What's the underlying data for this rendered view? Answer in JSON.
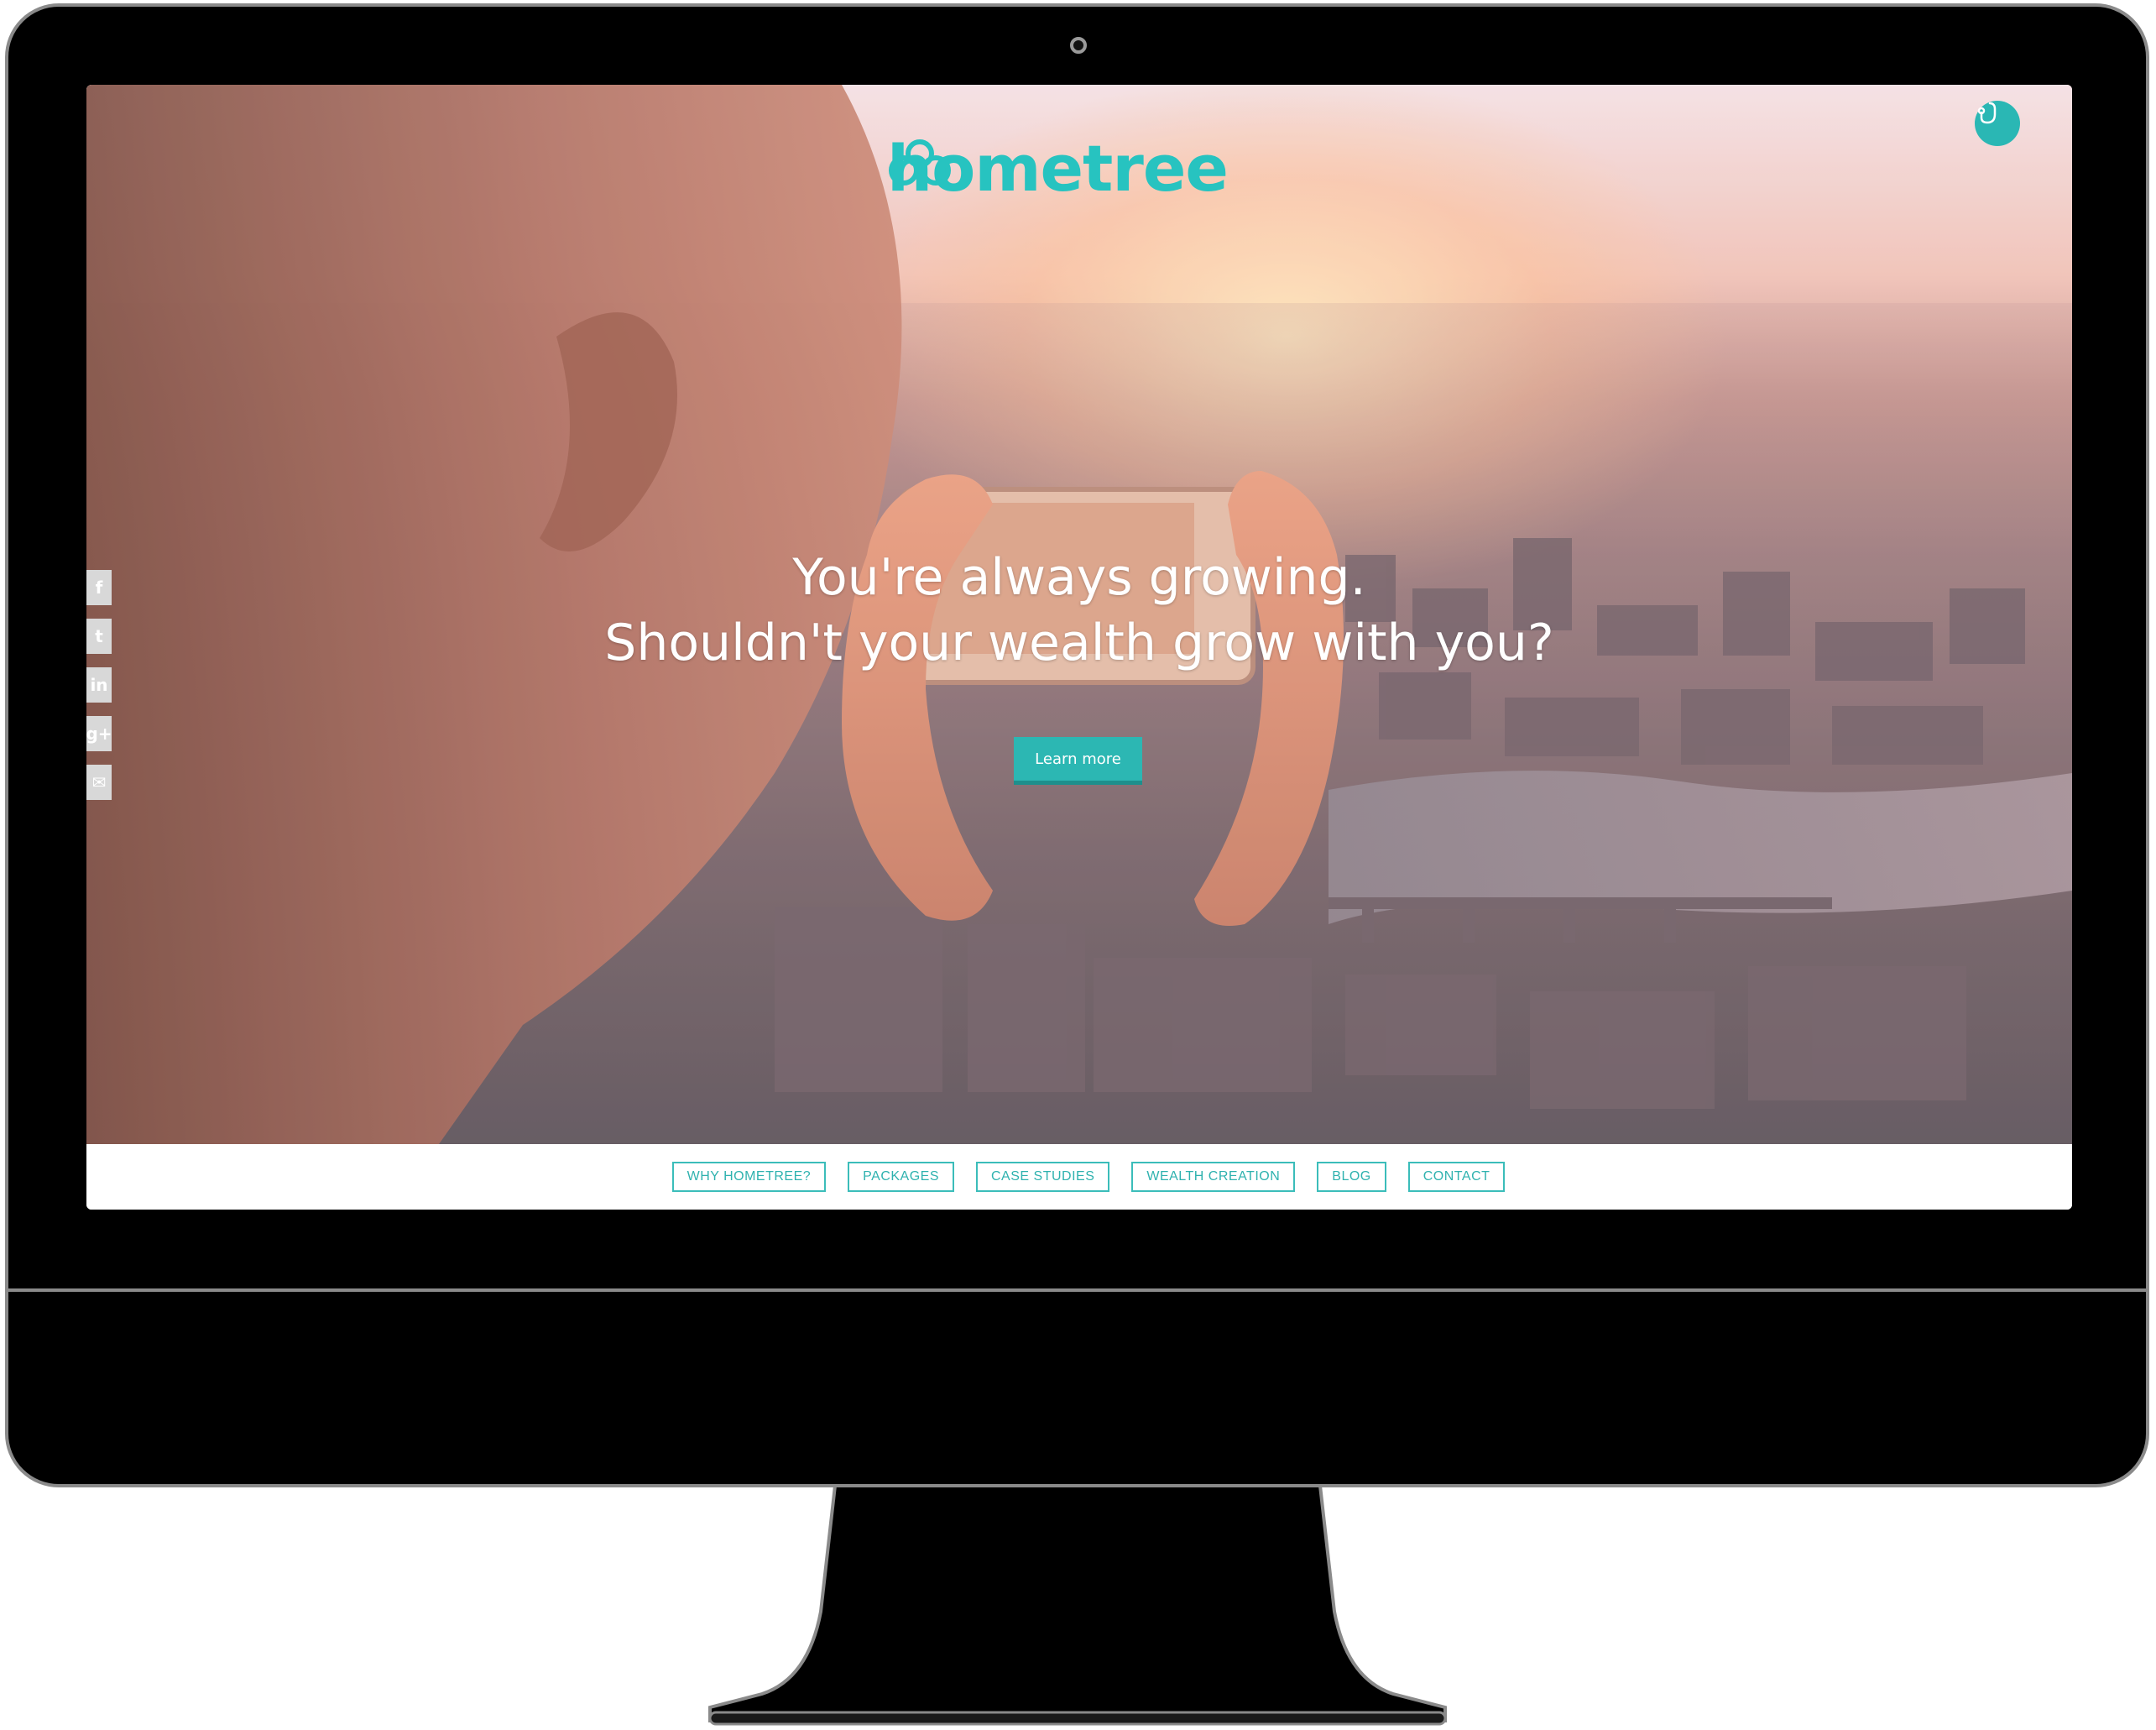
{
  "site": {
    "logo_text": "hometree",
    "brand_color": "#27c3c0"
  },
  "hero": {
    "headline_line1": "You're always growing.",
    "headline_line2": "Shouldn't your wealth grow with you?",
    "cta_label": "Learn more"
  },
  "social": {
    "items": [
      {
        "icon": "facebook-icon",
        "glyph": "f"
      },
      {
        "icon": "twitter-icon",
        "glyph": "t"
      },
      {
        "icon": "linkedin-icon",
        "glyph": "in"
      },
      {
        "icon": "google-plus-icon",
        "glyph": "g+"
      },
      {
        "icon": "email-icon",
        "glyph": "✉"
      }
    ]
  },
  "menu": {
    "icon": "stethoscope-icon"
  },
  "nav": {
    "items": [
      {
        "label": "WHY HOMETREE?"
      },
      {
        "label": "PACKAGES"
      },
      {
        "label": "CASE STUDIES"
      },
      {
        "label": "WEALTH CREATION"
      },
      {
        "label": "BLOG"
      },
      {
        "label": "CONTACT"
      }
    ]
  }
}
